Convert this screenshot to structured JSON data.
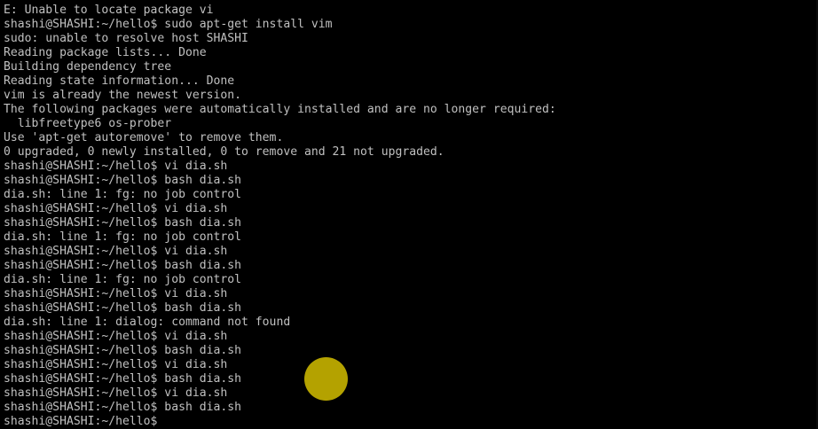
{
  "terminal": {
    "foreground": "#c0c0c0",
    "background": "#000000",
    "lines": [
      "E: Unable to locate package vi",
      "shashi@SHASHI:~/hello$ sudo apt-get install vim",
      "sudo: unable to resolve host SHASHI",
      "Reading package lists... Done",
      "Building dependency tree",
      "Reading state information... Done",
      "vim is already the newest version.",
      "The following packages were automatically installed and are no longer required:",
      "  libfreetype6 os-prober",
      "Use 'apt-get autoremove' to remove them.",
      "0 upgraded, 0 newly installed, 0 to remove and 21 not upgraded.",
      "shashi@SHASHI:~/hello$ vi dia.sh",
      "shashi@SHASHI:~/hello$ bash dia.sh",
      "dia.sh: line 1: fg: no job control",
      "shashi@SHASHI:~/hello$ vi dia.sh",
      "shashi@SHASHI:~/hello$ bash dia.sh",
      "dia.sh: line 1: fg: no job control",
      "shashi@SHASHI:~/hello$ vi dia.sh",
      "shashi@SHASHI:~/hello$ bash dia.sh",
      "dia.sh: line 1: fg: no job control",
      "shashi@SHASHI:~/hello$ vi dia.sh",
      "shashi@SHASHI:~/hello$ bash dia.sh",
      "dia.sh: line 1: dialog: command not found",
      "shashi@SHASHI:~/hello$ vi dia.sh",
      "shashi@SHASHI:~/hello$ bash dia.sh",
      "shashi@SHASHI:~/hello$ vi dia.sh",
      "shashi@SHASHI:~/hello$ bash dia.sh",
      "shashi@SHASHI:~/hello$ vi dia.sh",
      "shashi@SHASHI:~/hello$ bash dia.sh"
    ],
    "current_prompt": "shashi@SHASHI:~/hello$ ",
    "cursor_color": "#000000"
  },
  "click_indicator": {
    "icon": "click-highlight-circle",
    "color": "#c8b400"
  }
}
